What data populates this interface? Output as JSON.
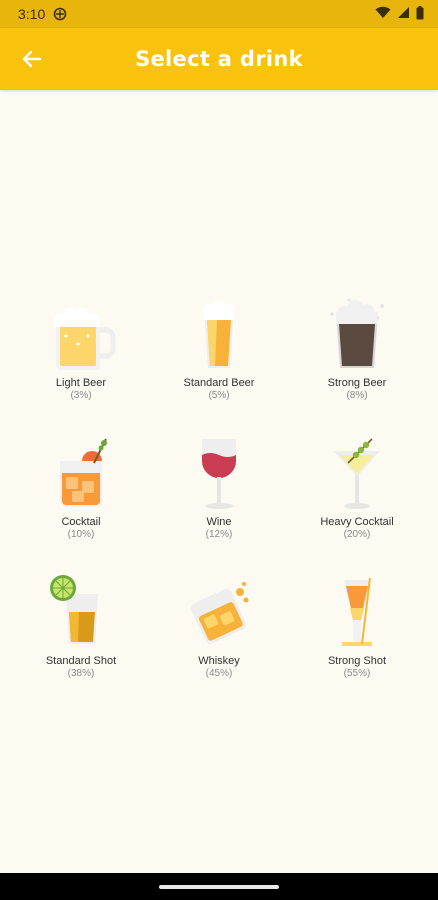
{
  "status_bar": {
    "time": "3:10"
  },
  "app_bar": {
    "title": "Select a drink"
  },
  "drinks": [
    {
      "name": "Light Beer",
      "abv": "(3%)",
      "icon": "light-beer-icon"
    },
    {
      "name": "Standard Beer",
      "abv": "(5%)",
      "icon": "standard-beer-icon"
    },
    {
      "name": "Strong Beer",
      "abv": "(8%)",
      "icon": "strong-beer-icon"
    },
    {
      "name": "Cocktail",
      "abv": "(10%)",
      "icon": "cocktail-icon"
    },
    {
      "name": "Wine",
      "abv": "(12%)",
      "icon": "wine-icon"
    },
    {
      "name": "Heavy Cocktail",
      "abv": "(20%)",
      "icon": "martini-icon"
    },
    {
      "name": "Standard Shot",
      "abv": "(38%)",
      "icon": "shot-lime-icon"
    },
    {
      "name": "Whiskey",
      "abv": "(45%)",
      "icon": "whiskey-icon"
    },
    {
      "name": "Strong Shot",
      "abv": "(55%)",
      "icon": "strong-shot-icon"
    }
  ],
  "colors": {
    "status_bar": "#e7b50b",
    "app_bar": "#f9c20d",
    "background": "#fdfaf2"
  }
}
